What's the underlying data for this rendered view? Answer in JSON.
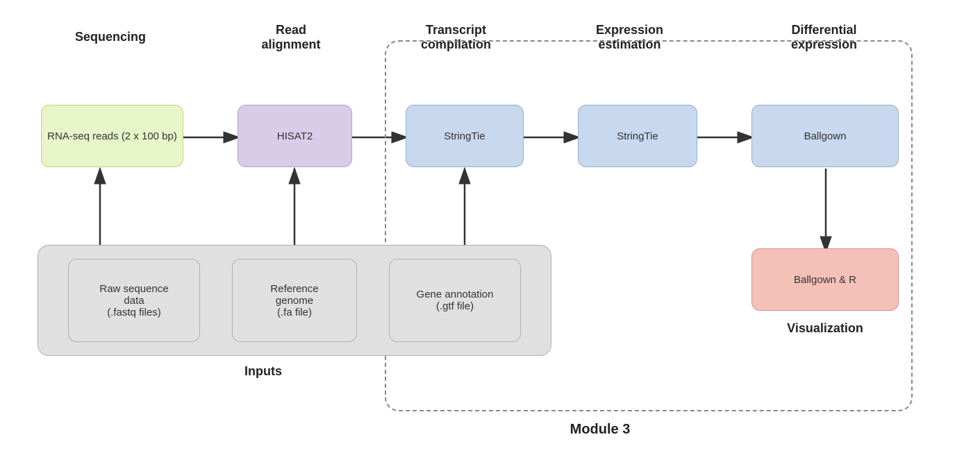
{
  "sections": {
    "sequencing": "Sequencing",
    "read_alignment": "Read\nalignment",
    "transcript_compilation": "Transcript\ncompilation",
    "expression_estimation": "Expression\nestimation",
    "differential_expression": "Differential\nexpression"
  },
  "boxes": {
    "rna_seq": "RNA-seq reads (2\nx 100 bp)",
    "hisat2": "HISAT2",
    "stringtie_compile": "StringTie",
    "stringtie_estimate": "StringTie",
    "ballgown": "Ballgown",
    "ballgown_r": "Ballgown & R",
    "raw_sequence": "Raw sequence\ndata\n(.fastq files)",
    "reference_genome": "Reference\ngenome\n(.fa file)",
    "gene_annotation": "Gene annotation\n(.gtf file)"
  },
  "labels": {
    "inputs": "Inputs",
    "module3": "Module 3",
    "visualization": "Visualization"
  }
}
